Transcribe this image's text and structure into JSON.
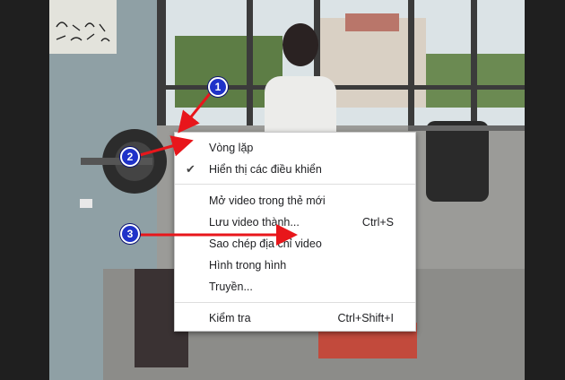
{
  "context_menu": {
    "items": [
      {
        "label": "Vòng lặp",
        "shortcut": "",
        "checked": false
      },
      {
        "label": "Hiển thị các điều khiển",
        "shortcut": "",
        "checked": true
      },
      {
        "label": "Mở video trong thẻ mới",
        "shortcut": "",
        "checked": false
      },
      {
        "label": "Lưu video thành...",
        "shortcut": "Ctrl+S",
        "checked": false
      },
      {
        "label": "Sao chép địa chỉ video",
        "shortcut": "",
        "checked": false
      },
      {
        "label": "Hình trong hình",
        "shortcut": "",
        "checked": false
      },
      {
        "label": "Truyền...",
        "shortcut": "",
        "checked": false
      },
      {
        "label": "Kiểm tra",
        "shortcut": "Ctrl+Shift+I",
        "checked": false
      }
    ],
    "check_glyph": "✔"
  },
  "annotations": {
    "badges": [
      "1",
      "2",
      "3"
    ],
    "color": "#e8161b",
    "badge_color": "#1f32c9"
  }
}
